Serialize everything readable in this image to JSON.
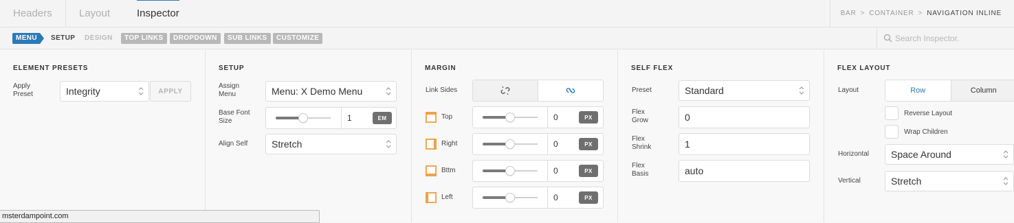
{
  "tabs": [
    "Headers",
    "Layout",
    "Inspector"
  ],
  "breadcrumb": [
    "BAR",
    "CONTAINER",
    "NAVIGATION INLINE"
  ],
  "subtabs": {
    "menu": "MENU",
    "setup": "SETUP",
    "design": "DESIGN",
    "top_links": "TOP LINKS",
    "dropdown": "DROPDOWN",
    "sub_links": "SUB LINKS",
    "customize": "CUSTOMIZE"
  },
  "search": {
    "placeholder": "Search Inspector."
  },
  "presets": {
    "title": "ELEMENT PRESETS",
    "apply_label": "Apply Preset",
    "preset_value": "Integrity",
    "apply_button": "APPLY"
  },
  "setup": {
    "title": "SETUP",
    "assign_menu_label": "Assign Menu",
    "assign_menu_value": "Menu: X Demo Menu",
    "font_size_label": "Base Font Size",
    "font_size_value": "1",
    "font_size_unit": "EM",
    "font_size_slider": 0.5,
    "align_self_label": "Align Self",
    "align_self_value": "Stretch"
  },
  "margin": {
    "title": "MARGIN",
    "link_sides_label": "Link Sides",
    "sides": [
      {
        "label": "Top",
        "value": "0",
        "unit": "PX",
        "slider": 0.5
      },
      {
        "label": "Right",
        "value": "0",
        "unit": "PX",
        "slider": 0.5
      },
      {
        "label": "Bttm",
        "value": "0",
        "unit": "PX",
        "slider": 0.5
      },
      {
        "label": "Left",
        "value": "0",
        "unit": "PX",
        "slider": 0.5
      }
    ]
  },
  "self_flex": {
    "title": "SELF FLEX",
    "preset_label": "Preset",
    "preset_value": "Standard",
    "grow_label": "Flex Grow",
    "grow_value": "0",
    "shrink_label": "Flex Shrink",
    "shrink_value": "1",
    "basis_label": "Flex Basis",
    "basis_value": "auto"
  },
  "flex_layout": {
    "title": "FLEX LAYOUT",
    "layout_label": "Layout",
    "row_label": "Row",
    "column_label": "Column",
    "reverse_label": "Reverse Layout",
    "wrap_label": "Wrap Children",
    "horizontal_label": "Horizontal",
    "horizontal_value": "Space Around",
    "vertical_label": "Vertical",
    "vertical_value": "Stretch"
  },
  "status_url": "msterdampoint.com",
  "colors": {
    "accent": "#2a7ab8",
    "side_icon": "#f0a04b",
    "unit_badge": "#6f6f6f"
  }
}
